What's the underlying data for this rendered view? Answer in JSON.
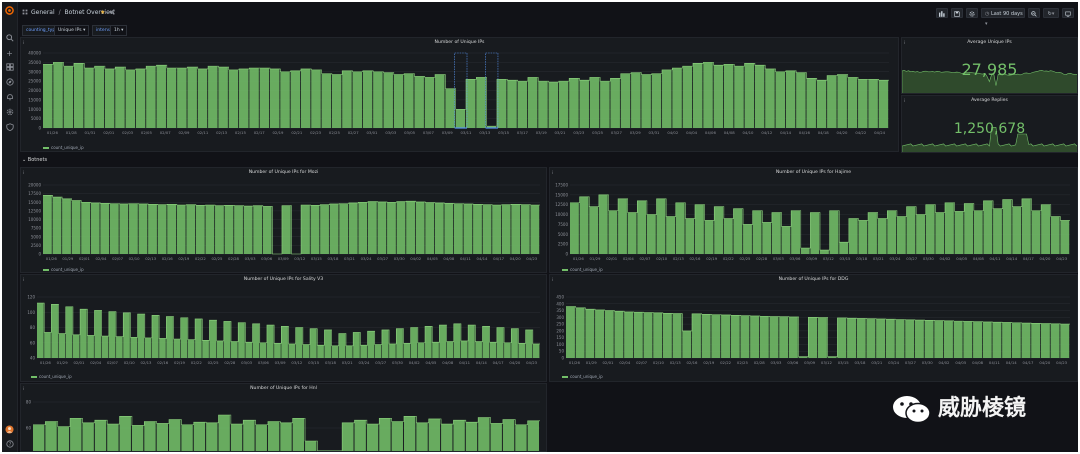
{
  "breadcrumb": {
    "folder": "General",
    "separator": "/",
    "dashboard": "Botnet Overview"
  },
  "toolbar": {
    "time_range": "Last 90 days"
  },
  "variables": [
    {
      "label": "counting_type",
      "value": "Unique IPs"
    },
    {
      "label": "interval",
      "value": "1h"
    }
  ],
  "row_title": "Botnets",
  "watermark": "威胁棱镜",
  "colors": {
    "series": "#73bf69",
    "bg": "#111217",
    "panel": "#181b1f",
    "highlight": "#5794f2"
  },
  "icons": [
    "grafana-logo-icon",
    "search-icon",
    "plus-icon",
    "dashboards-icon",
    "explore-icon",
    "alerting-icon",
    "config-icon",
    "shield-icon",
    "user-avatar-icon",
    "help-icon"
  ],
  "main_panel": {
    "title": "Number of Unique IPs",
    "legend": "count_unique_ip",
    "chart_data": {
      "type": "area",
      "title": "Number of Unique IPs",
      "xlabel": "",
      "ylabel": "",
      "y_ticks": [
        "40000",
        "35000",
        "30000",
        "25000",
        "20000",
        "15000",
        "10000",
        "5000",
        "0"
      ],
      "ylim": [
        0,
        40000
      ],
      "x_ticks": [
        "01/26",
        "01/28",
        "01/31",
        "02/01",
        "02/03",
        "02/05",
        "02/07",
        "02/09",
        "02/11",
        "02/13",
        "02/15",
        "02/17",
        "02/19",
        "02/21",
        "02/23",
        "02/25",
        "02/27",
        "03/01",
        "03/03",
        "03/05",
        "03/07",
        "03/09",
        "03/11",
        "03/13",
        "03/15",
        "03/17",
        "03/19",
        "03/21",
        "03/23",
        "03/25",
        "03/27",
        "03/29",
        "03/31",
        "04/02",
        "04/04",
        "04/06",
        "04/08",
        "04/10",
        "04/12",
        "04/14",
        "04/16",
        "04/18",
        "04/20",
        "04/22",
        "04/24"
      ],
      "series": [
        {
          "name": "count_unique_ip",
          "values": [
            34000,
            35000,
            33000,
            34500,
            32000,
            33000,
            31500,
            32500,
            31000,
            31500,
            33000,
            33500,
            32000,
            32000,
            32500,
            31500,
            33000,
            32500,
            31000,
            31500,
            32000,
            32000,
            31500,
            30000,
            30500,
            31500,
            31000,
            29000,
            28500,
            30500,
            30000,
            30500,
            30000,
            29500,
            28500,
            29000,
            27500,
            27000,
            28500,
            21000,
            10000,
            26000,
            27000,
            1000,
            26000,
            25500,
            25000,
            27000,
            25000,
            24500,
            25000,
            26500,
            25500,
            27000,
            25000,
            26500,
            29000,
            29500,
            28500,
            29000,
            31000,
            32000,
            33000,
            34500,
            35000,
            33500,
            34000,
            33000,
            34500,
            33500,
            31500,
            30000,
            30500,
            29500,
            26500,
            25500,
            28000,
            28500,
            27000,
            26000,
            26000,
            25500
          ]
        }
      ]
    }
  },
  "stat_panels": [
    {
      "title": "Average Unique IPs",
      "value": "27,985"
    },
    {
      "title": "Average Replies",
      "value": "1,250,678"
    }
  ],
  "panels": [
    {
      "title": "Number of Unique IPs for Mozi",
      "legend": "count_unique_ip",
      "chart_data": {
        "type": "area",
        "title": "Number of Unique IPs for Mozi",
        "ylim": [
          0,
          20000
        ],
        "y_ticks": [
          "20000",
          "17500",
          "15000",
          "12500",
          "10000",
          "7500",
          "5000",
          "2500",
          "0"
        ],
        "x_ticks": [
          "01/26",
          "01/29",
          "02/01",
          "02/04",
          "02/07",
          "02/10",
          "02/13",
          "02/16",
          "02/19",
          "02/22",
          "02/25",
          "02/28",
          "03/03",
          "03/06",
          "03/09",
          "03/12",
          "03/15",
          "03/18",
          "03/21",
          "03/24",
          "03/27",
          "03/30",
          "04/02",
          "04/05",
          "04/08",
          "04/11",
          "04/14",
          "04/17",
          "04/20",
          "04/23"
        ],
        "series": [
          {
            "name": "count_unique_ip",
            "values": [
              17000,
              16500,
              16000,
              15500,
              15000,
              14800,
              14700,
              14600,
              14500,
              14600,
              14500,
              14400,
              14300,
              14400,
              14200,
              14300,
              14100,
              14200,
              14000,
              14100,
              14000,
              13900,
              14000,
              13800,
              0,
              14000,
              0,
              14200,
              14100,
              14300,
              14500,
              14600,
              14800,
              15000,
              15200,
              15100,
              15000,
              15200,
              15300,
              15100,
              14900,
              14800,
              14700,
              14600,
              14500,
              14400,
              14300,
              14200,
              14300,
              14400,
              14300,
              14200
            ]
          }
        ]
      }
    },
    {
      "title": "Number of Unique IPs for Hajime",
      "legend": "count_unique_ip",
      "chart_data": {
        "type": "area",
        "title": "Number of Unique IPs for Hajime",
        "ylim": [
          0,
          17500
        ],
        "y_ticks": [
          "17500",
          "15000",
          "12500",
          "10000",
          "7500",
          "5000",
          "2500",
          "0"
        ],
        "x_ticks": [
          "01/26",
          "01/29",
          "02/01",
          "02/04",
          "02/07",
          "02/10",
          "02/13",
          "02/16",
          "02/19",
          "02/22",
          "02/25",
          "02/28",
          "03/03",
          "03/06",
          "03/09",
          "03/12",
          "03/15",
          "03/18",
          "03/21",
          "03/24",
          "03/27",
          "03/30",
          "04/02",
          "04/05",
          "04/08",
          "04/11",
          "04/14",
          "04/17",
          "04/20",
          "04/23"
        ],
        "series": [
          {
            "name": "count_unique_ip",
            "values": [
              13000,
              14500,
              12000,
              15000,
              11000,
              14000,
              10500,
              13500,
              10000,
              14000,
              9500,
              13000,
              9000,
              12500,
              8500,
              12000,
              9000,
              11500,
              7500,
              11000,
              8000,
              10500,
              7000,
              11000,
              1500,
              10500,
              1000,
              11000,
              3000,
              9000,
              8500,
              10500,
              9000,
              11000,
              9500,
              12000,
              10000,
              12500,
              10500,
              13000,
              10800,
              12800,
              11000,
              13500,
              11500,
              13800,
              12000,
              14000,
              11000,
              12500,
              9500,
              8500
            ]
          }
        ]
      }
    },
    {
      "title": "Number of Unique IPs for Sality V3",
      "legend": "count_unique_ip",
      "chart_data": {
        "type": "area",
        "title": "Number of Unique IPs for Sality V3",
        "ylim": [
          20,
          120
        ],
        "y_ticks": [
          "120",
          "100",
          "80",
          "60",
          "40"
        ],
        "x_ticks": [
          "01/26",
          "01/29",
          "02/01",
          "02/04",
          "02/07",
          "02/10",
          "02/13",
          "02/16",
          "02/19",
          "02/22",
          "02/25",
          "02/28",
          "03/03",
          "03/06",
          "03/09",
          "03/12",
          "03/15",
          "03/18",
          "03/21",
          "03/24",
          "03/27",
          "03/30",
          "04/02",
          "04/05",
          "04/08",
          "04/11",
          "04/14",
          "04/17",
          "04/20",
          "04/23"
        ],
        "series": [
          {
            "name": "count_unique_ip",
            "values": [
              110,
              62,
              108,
              60,
              104,
              58,
              100,
              57,
              98,
              56,
              96,
              55,
              94,
              54,
              92,
              53,
              90,
              52,
              88,
              51,
              86,
              50,
              84,
              49,
              82,
              48,
              80,
              47,
              78,
              46,
              76,
              45,
              74,
              44,
              72,
              43,
              70,
              42,
              68,
              41,
              66,
              40,
              60,
              40,
              62,
              41,
              64,
              42,
              66,
              43,
              68,
              44,
              70,
              45,
              72,
              46,
              74,
              47,
              76,
              48,
              74,
              47,
              72,
              46,
              70,
              45,
              68,
              44,
              66,
              43
            ]
          }
        ]
      }
    },
    {
      "title": "Number of Unique IPs for DDG",
      "legend": "count_unique_ip",
      "chart_data": {
        "type": "area",
        "title": "Number of Unique IPs for DDG",
        "ylim": [
          0,
          450
        ],
        "y_ticks": [
          "450",
          "400",
          "350",
          "300",
          "250",
          "200",
          "150",
          "100",
          "50",
          "0"
        ],
        "x_ticks": [
          "01/26",
          "01/29",
          "02/01",
          "02/04",
          "02/07",
          "02/10",
          "02/13",
          "02/16",
          "02/19",
          "02/22",
          "02/25",
          "02/28",
          "03/03",
          "03/06",
          "03/09",
          "03/12",
          "03/15",
          "03/18",
          "03/21",
          "03/24",
          "03/27",
          "03/30",
          "04/02",
          "04/05",
          "04/08",
          "04/11",
          "04/14",
          "04/17",
          "04/20",
          "04/23"
        ],
        "series": [
          {
            "name": "count_unique_ip",
            "values": [
              380,
              370,
              360,
              355,
              350,
              345,
              340,
              338,
              335,
              333,
              330,
              328,
              200,
              326,
              322,
              320,
              318,
              315,
              312,
              310,
              308,
              306,
              305,
              303,
              10,
              300,
              298,
              10,
              296,
              294,
              292,
              290,
              288,
              286,
              284,
              282,
              280,
              278,
              276,
              274,
              272,
              270,
              268,
              266,
              264,
              262,
              260,
              258,
              256,
              254,
              252,
              250
            ]
          }
        ]
      }
    },
    {
      "title": "Number of Unique IPs for Hnl",
      "legend": "",
      "chart_data": {
        "type": "area",
        "title": "Number of Unique IPs for Hnl",
        "ylim": [
          0,
          80
        ],
        "y_ticks": [
          "80",
          "60",
          "40"
        ],
        "x_ticks": [],
        "series": [
          {
            "name": "",
            "values": [
              45,
              50,
              42,
              55,
              48,
              52,
              46,
              58,
              44,
              50,
              47,
              53,
              45,
              49,
              48,
              60,
              46,
              52,
              45,
              50,
              48,
              55,
              20,
              5,
              5,
              48,
              52,
              46,
              55,
              50,
              58,
              48,
              54,
              46,
              52,
              49,
              56,
              47,
              53,
              45,
              51
            ]
          }
        ]
      }
    }
  ]
}
